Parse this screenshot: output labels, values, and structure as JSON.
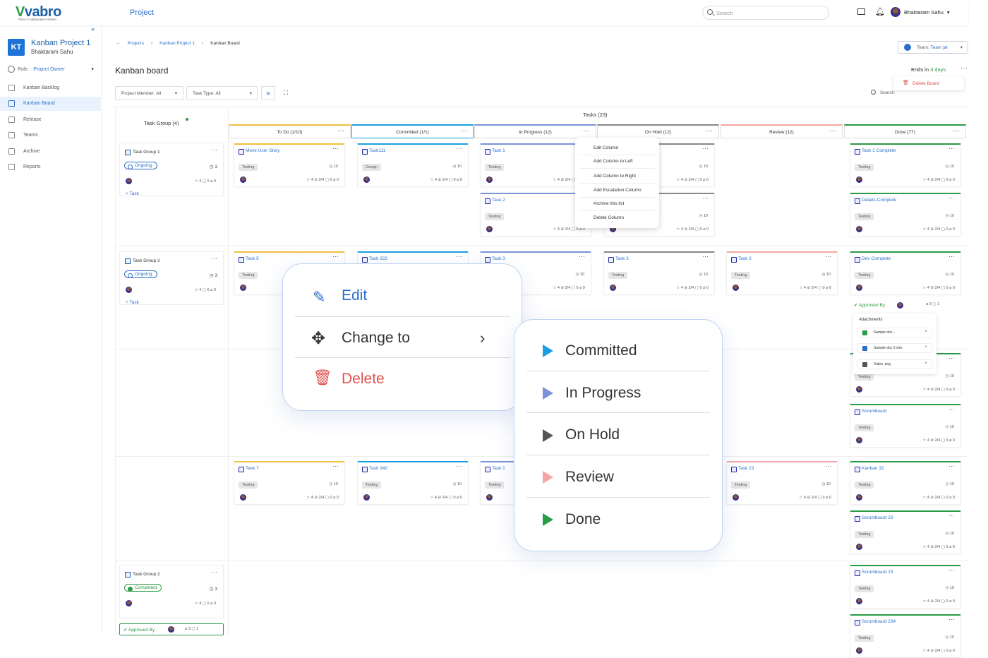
{
  "app": {
    "logo": "vabro",
    "tagline": "Plan • Collaborate • Deliver",
    "section": "Project",
    "search_placeholder": "Search",
    "user": "Bhaktaram Sahu"
  },
  "sidebar": {
    "initials": "KT",
    "project": "Kanban Project 1",
    "owner": "Bhaktaram Sahu",
    "role_label": "Role",
    "role_value": "Project Owner",
    "items": [
      "Kanban Backlog",
      "Kanban Board",
      "Release",
      "Teams",
      "Archive",
      "Reports"
    ]
  },
  "breadcrumb": [
    "Projects",
    "Kanban Project 1",
    "Kanban Board"
  ],
  "page": {
    "title": "Kanban board",
    "team_label": "Team:",
    "team_value": "Team jal",
    "ends_prefix": "Ends in",
    "ends_value": "3 days",
    "delete_board": "Delete Board",
    "filter_member": "Project Member: All",
    "filter_type": "Task Type: All",
    "board_search": "Search"
  },
  "board": {
    "task_group_header": "Task Group (4)",
    "tasks_header": "Tasks (23)",
    "columns": [
      "To Do (1/10)",
      "Committed (1/1)",
      "In Progress (12)",
      "On Hold (12)",
      "Review (12)",
      "Done (77)"
    ],
    "column_colors": [
      "#f0c040",
      "#1aa0e0",
      "#7b92d6",
      "#888888",
      "#f4a6a6",
      "#2a9b46"
    ]
  },
  "groups": [
    {
      "title": "Task Group 1",
      "status": "Ongoing",
      "count": "3",
      "meta": "☆ 4   ▢ 0   ⌀ 0",
      "add": "+ Task"
    },
    {
      "title": "Task Group 2",
      "status": "Ongoing",
      "count": "3",
      "meta": "☆ 4   ▢ 0   ⌀ 0",
      "add": "+ Task"
    },
    {
      "title": "Task Group 2",
      "status": "Completed",
      "count": "3",
      "meta": "☆ 4   ▢ 0   ⌀ 0",
      "add": ""
    }
  ],
  "cards": [
    {
      "title": "Move User Story",
      "tag": "Testing",
      "est": "10"
    },
    {
      "title": "Task111",
      "tag": "Design",
      "est": "10"
    },
    {
      "title": "Task 1",
      "tag": "Testing",
      "est": "10"
    },
    {
      "title": "Task 1",
      "tag": "Testing",
      "est": "10"
    },
    {
      "title": "Task 1 Complete",
      "tag": "Testing",
      "est": "10"
    },
    {
      "title": "Task 2",
      "tag": "Testing",
      "est": "10"
    },
    {
      "title": "Task 2",
      "tag": "Testing",
      "est": "10"
    },
    {
      "title": "Details Complete",
      "tag": "Testing",
      "est": "10"
    },
    {
      "title": "Task 5",
      "tag": "Testing",
      "est": "10"
    },
    {
      "title": "Task 222",
      "tag": "Testing",
      "est": "10"
    },
    {
      "title": "Task 3",
      "tag": "Testing",
      "est": "10"
    },
    {
      "title": "Task 3",
      "tag": "Testing",
      "est": "10"
    },
    {
      "title": "Task 3",
      "tag": "Testing",
      "est": "10"
    },
    {
      "title": "Dev Complete",
      "tag": "Testing",
      "est": "10"
    },
    {
      "title": "Testing",
      "tag": "Testing",
      "est": "10"
    },
    {
      "title": "Scrumboard",
      "tag": "Testing",
      "est": "10"
    },
    {
      "title": "Task 7",
      "tag": "Testing",
      "est": "10"
    },
    {
      "title": "Task 342",
      "tag": "Testing",
      "est": "10"
    },
    {
      "title": "Task 1",
      "tag": "Testing",
      "est": "10"
    },
    {
      "title": "Task 23",
      "tag": "Testing",
      "est": "10"
    },
    {
      "title": "Kanban 32",
      "tag": "Testing",
      "est": "10"
    },
    {
      "title": "Scrumboard 23",
      "tag": "Testing",
      "est": "10"
    },
    {
      "title": "Scrumboard 23",
      "tag": "Testing",
      "est": "10"
    },
    {
      "title": "Scrumboard 234",
      "tag": "Testing",
      "est": "10"
    }
  ],
  "card_meta": "☆ 4   ⊘ 2/4   ▢ 0   ⌀ 0",
  "approved": {
    "label": "Approved By",
    "meta": "⌀ 3    ▢ 1"
  },
  "attachments": {
    "title": "Attachments",
    "files": [
      "Sample doc...",
      "Sample doc 2.xlsx",
      "Vabro. png"
    ]
  },
  "context_menu": [
    "Edit Column",
    "Add Column to Left",
    "Add Column to Right",
    "Add Escalation Column",
    "Archive this list",
    "Delete Column"
  ],
  "zoom_menu": {
    "edit": "Edit",
    "change": "Change to",
    "delete": "Delete"
  },
  "change_menu": [
    "Committed",
    "In Progress",
    "On Hold",
    "Review",
    "Done"
  ]
}
